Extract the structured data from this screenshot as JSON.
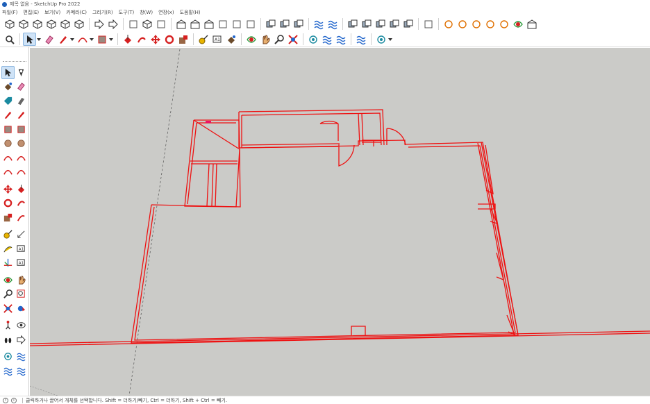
{
  "window": {
    "title": "제목 없음 - SketchUp Pro 2022"
  },
  "menu": [
    {
      "label": "파일(F)"
    },
    {
      "label": "편집(E)"
    },
    {
      "label": "보기(V)"
    },
    {
      "label": "카메라(C)"
    },
    {
      "label": "그리기(R)"
    },
    {
      "label": "도구(T)"
    },
    {
      "label": "창(W)"
    },
    {
      "label": "연장(x)"
    },
    {
      "label": "도움말(H)"
    }
  ],
  "toolbar_row_1": [
    "iso-view-icon",
    "top-view-icon",
    "front-view-icon",
    "right-view-icon",
    "back-view-icon",
    "left-view-icon",
    "sep",
    "section-plane-icon",
    "section-display-icon",
    "sep",
    "xray-icon",
    "back-edges-icon",
    "wireframe-icon",
    "sep",
    "warehouse-icon",
    "share-model-icon",
    "extension-warehouse-icon",
    "layout-icon",
    "styles-icon",
    "components-icon",
    "sep",
    "outer-shell-icon",
    "intersect-icon",
    "union-icon",
    "sep",
    "sandbox-from-contours-icon",
    "sandbox-from-scratch-icon",
    "sep",
    "solid-union-icon",
    "solid-subtract-icon",
    "solid-trim-icon",
    "solid-split-icon",
    "solid-intersect-icon",
    "sep",
    "photo-match-icon",
    "sep",
    "geo-location-icon",
    "terrain-icon",
    "sun-icon",
    "shadow-icon",
    "fog-icon",
    "orbit-3d-icon",
    "extension-icon"
  ],
  "toolbar_row_2": [
    "search-icon",
    "sep",
    "select-icon",
    "dropdown",
    "eraser-icon",
    "pencil-icon",
    "dropdown",
    "arc-icon",
    "dropdown",
    "rectangle-icon",
    "dropdown",
    "sep",
    "push-pull-icon",
    "follow-me-icon",
    "move-icon",
    "rotate-icon",
    "scale-icon",
    "sep",
    "tape-measure-icon",
    "text-icon",
    "paint-bucket-icon",
    "sep",
    "orbit-icon",
    "pan-icon",
    "zoom-icon",
    "zoom-extents-icon",
    "sep",
    "outliner-icon",
    "soften-icon",
    "layers-icon",
    "sep",
    "sandbox-icon",
    "sep",
    "profile-icon",
    "dropdown"
  ],
  "left_toolbar": [
    [
      "select-icon",
      "make-component-icon"
    ],
    [
      "paint-bucket-icon",
      "eraser-icon"
    ],
    [
      "tag-icon",
      "smoove-icon"
    ],
    [
      "pencil-icon",
      "freehand-icon"
    ],
    [
      "rectangle-icon",
      "rotated-rectangle-icon"
    ],
    [
      "circle-icon",
      "polygon-icon"
    ],
    [
      "arc-icon",
      "two-point-arc-icon"
    ],
    [
      "three-point-arc-icon",
      "pie-icon"
    ],
    [
      "gap"
    ],
    [
      "move-icon",
      "push-pull-icon"
    ],
    [
      "rotate-icon",
      "follow-me-icon"
    ],
    [
      "scale-icon",
      "offset-icon"
    ],
    [
      "gap"
    ],
    [
      "tape-measure-icon",
      "dimension-icon"
    ],
    [
      "protractor-icon",
      "text-icon"
    ],
    [
      "axes-icon",
      "3d-text-icon"
    ],
    [
      "gap"
    ],
    [
      "orbit-icon",
      "pan-icon"
    ],
    [
      "zoom-icon",
      "zoom-window-icon"
    ],
    [
      "zoom-extents-icon",
      "previous-view-icon"
    ],
    [
      "gap"
    ],
    [
      "position-camera-icon",
      "look-around-icon"
    ],
    [
      "walk-icon",
      "section-plane-icon"
    ],
    [
      "gap"
    ],
    [
      "outliner-icon",
      "soften-icon"
    ],
    [
      "layers-icon",
      "sandbox-icon"
    ]
  ],
  "viewport": {
    "background": "#cbcbc8",
    "line_color": "#ee1111"
  },
  "statusbar": {
    "icon_1": "?",
    "icon_2": "i",
    "message": "클릭하거나 끌어서 개체를 선택합니다. Shift = 더하기/빼기, Ctrl = 더하기, Shift + Ctrl = 빼기."
  }
}
